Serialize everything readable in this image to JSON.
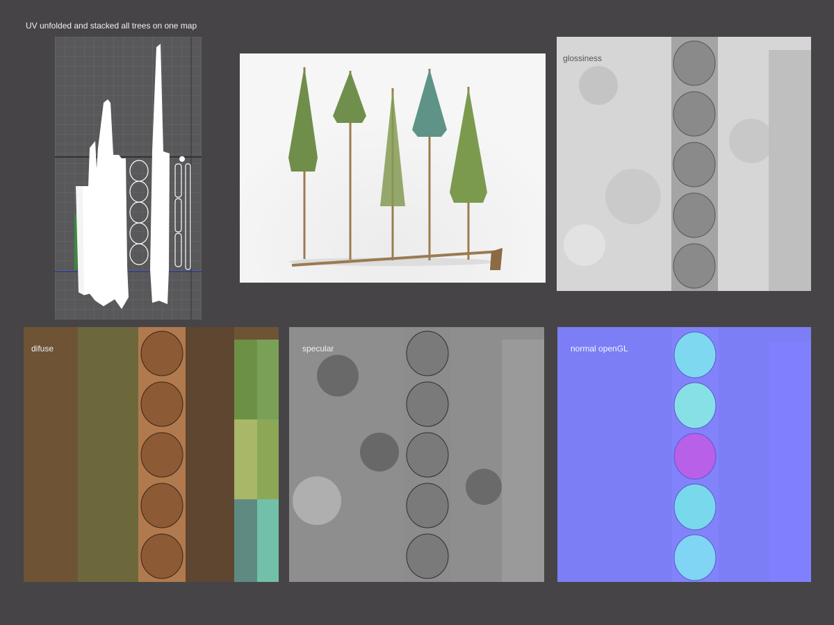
{
  "header": {
    "caption": "UV unfolded and stacked all trees on one map"
  },
  "panels": {
    "glossiness": {
      "label": "glossiness"
    },
    "diffuse": {
      "label": "difuse"
    },
    "specular": {
      "label": "specular"
    },
    "normal": {
      "label": "normal openGL"
    }
  },
  "colors": {
    "background": "#464446",
    "uv_viewport": "#58585a",
    "render_bg": "#f2f2f2",
    "glossiness": "#d6d6d6",
    "diffuse": "#6e5335",
    "specular": "#8e8e8e",
    "normal": "#7c7ef5"
  }
}
